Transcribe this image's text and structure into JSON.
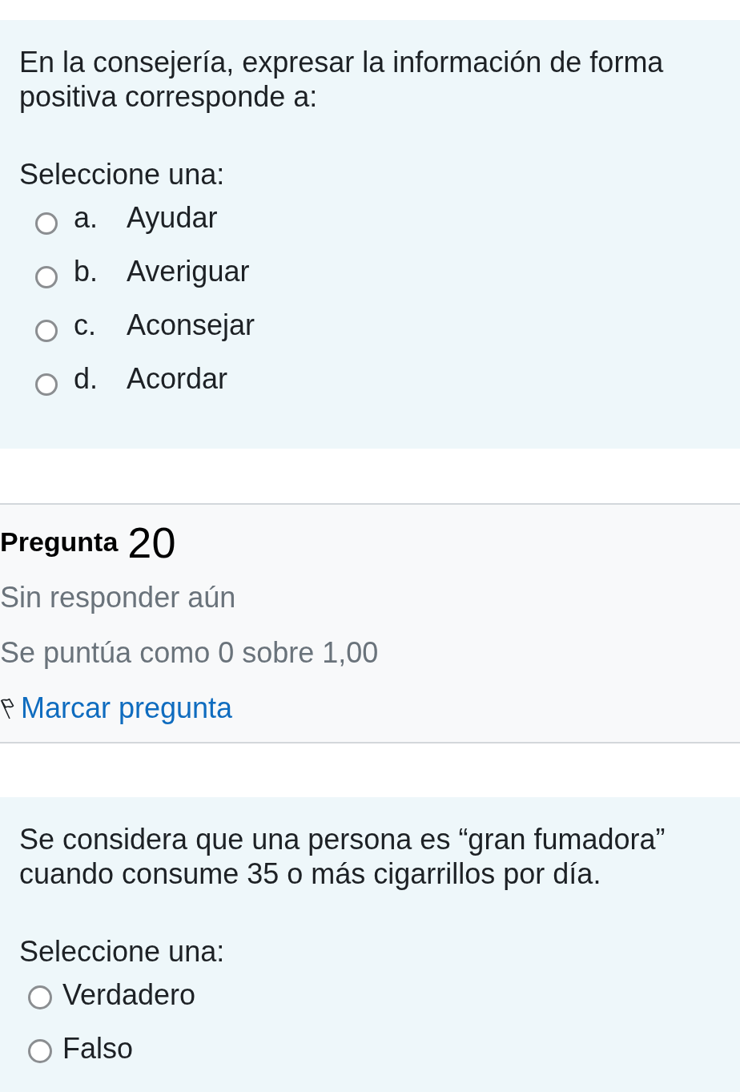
{
  "blocks": [
    {
      "kind": "question",
      "text": "En la consejería, expresar la información de forma positiva corresponde a:",
      "prompt": "Seleccione una:",
      "options": [
        {
          "letter": "a.",
          "label": "Ayudar",
          "selected": false
        },
        {
          "letter": "b.",
          "label": "Averiguar",
          "selected": false
        },
        {
          "letter": "c.",
          "label": "Aconsejar",
          "selected": false
        },
        {
          "letter": "d.",
          "label": "Acordar",
          "selected": false
        }
      ]
    },
    {
      "kind": "info",
      "title": "Pregunta",
      "number": "20",
      "status": "Sin responder aún",
      "grade": "Se puntúa como 0 sobre 1,00",
      "flag_link": "Marcar pregunta",
      "flagged": false
    },
    {
      "kind": "question",
      "text": "Se considera que una persona es “gran fumadora” cuando consume 35 o más cigarrillos por día.",
      "prompt": "Seleccione una:",
      "options": [
        {
          "label": "Verdadero",
          "selected": false
        },
        {
          "label": "Falso",
          "selected": false
        }
      ]
    }
  ]
}
